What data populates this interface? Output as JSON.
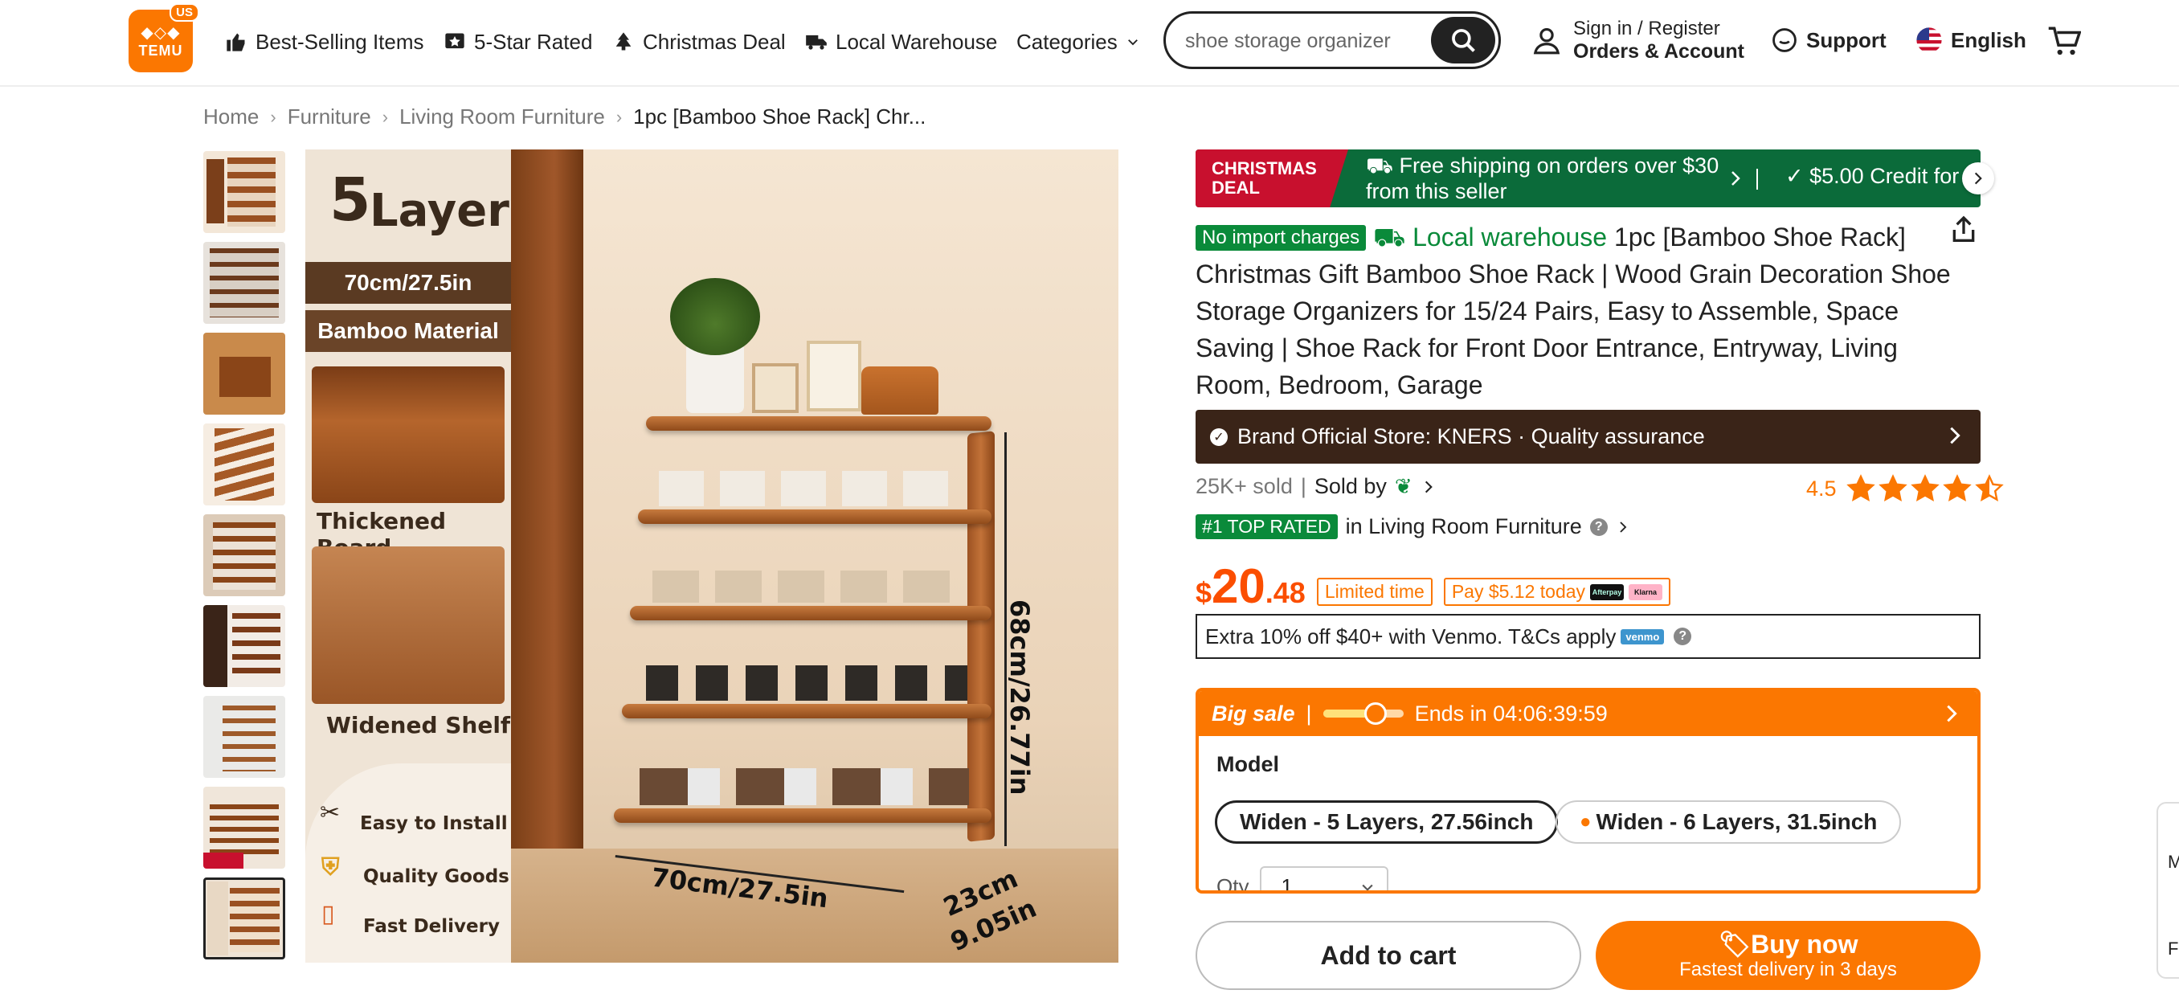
{
  "header": {
    "logo_text": "TEMU",
    "region": "US",
    "nav": [
      {
        "label": "Best-Selling Items",
        "icon": "thumbs-up-icon"
      },
      {
        "label": "5-Star Rated",
        "icon": "star-badge-icon"
      },
      {
        "label": "Christmas Deal",
        "icon": "christmas-tree-icon"
      },
      {
        "label": "Local Warehouse",
        "icon": "truck-icon"
      },
      {
        "label": "Categories",
        "icon": "chevron-down-icon"
      }
    ],
    "search": {
      "value": "shoe storage organizer"
    },
    "account": {
      "line1": "Sign in / Register",
      "line2": "Orders & Account"
    },
    "support": "Support",
    "language": "English",
    "colors": {
      "brand": "#fb7701"
    }
  },
  "breadcrumb": [
    "Home",
    "Furniture",
    "Living Room Furniture",
    "1pc [Bamboo Shoe Rack] Chr..."
  ],
  "gallery": {
    "thumb_count": 9,
    "active_index": 8,
    "art": {
      "headline_num": "5",
      "headline_word": "Layer",
      "size_band": "70cm/27.5in",
      "material_band": "Bamboo Material",
      "feature_1": "Thickened Board",
      "feature_2": "Widened Shelf",
      "perk_1": "Easy to Install",
      "perk_2": "Quality Goods",
      "perk_3": "Fast Delivery",
      "height_label": "68cm/26.77in",
      "width_label": "70cm/27.5in",
      "depth_label_1": "23cm",
      "depth_label_2": "9.05in"
    }
  },
  "promo": {
    "tag_line1": "CHRISTMAS",
    "tag_line2": "DEAL",
    "shipping": "Free shipping on orders over $30 from this seller",
    "credit": "$5.00 Credit for"
  },
  "product": {
    "badge_import": "No import charges",
    "local_warehouse": "Local warehouse",
    "title": "1pc [Bamboo Shoe Rack] Christmas Gift Bamboo Shoe Rack | Wood Grain Decoration Shoe Storage Organizers for 15/24 Pairs, Easy to Assemble, Space Saving | Shoe Rack for Front Door Entrance, Entryway, Living Room, Bedroom, Garage",
    "brand_bar": "Brand Official Store: KNERS · Quality assurance",
    "sold": "25K+ sold",
    "sold_by": "Sold by",
    "rating": "4.5",
    "rating_value": 4.5,
    "top_rated_badge": "#1 TOP RATED",
    "top_rated_in": "in Living Room Furniture",
    "price_currency": "$",
    "price_int": "20",
    "price_dec": ".48",
    "limited_time": "Limited time",
    "pay_today": "Pay $5.12 today",
    "pay_providers": [
      "Afterpay",
      "Klarna"
    ],
    "venmo": "Extra 10% off $40+ with Venmo. T&Cs apply",
    "venmo_badge": "venmo"
  },
  "sale": {
    "label": "Big sale",
    "ends": "Ends in 04:06:39:59",
    "progress": 0.65,
    "model_label": "Model",
    "options": [
      {
        "label": "Widen - 5 Layers, 27.56inch",
        "selected": true
      },
      {
        "label": "Widen - 6 Layers, 31.5inch",
        "selected": false
      }
    ],
    "qty_label": "Qty",
    "qty_value": "1"
  },
  "actions": {
    "add_to_cart": "Add to cart",
    "buy_now": "Buy now",
    "buy_sub": "Fastest delivery in 3 days"
  },
  "side_tab": {
    "line1": "M",
    "line2": "Fe"
  }
}
